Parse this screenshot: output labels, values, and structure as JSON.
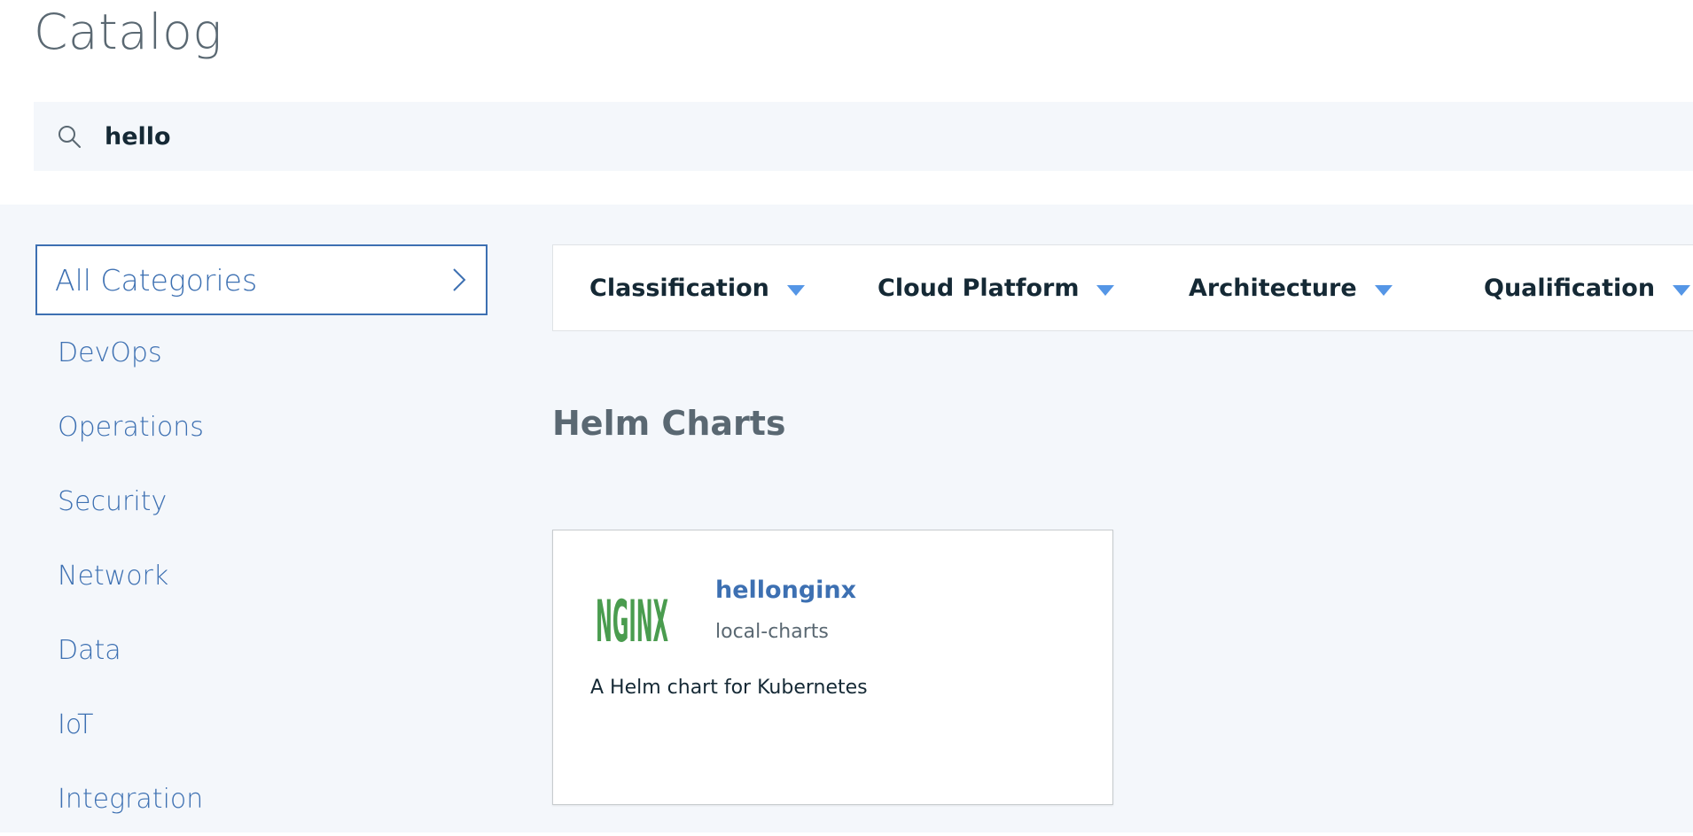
{
  "page": {
    "title": "Catalog"
  },
  "search": {
    "value": "hello",
    "icon": "search-icon"
  },
  "sidebar": {
    "all_categories_label": "All Categories",
    "categories": [
      "DevOps",
      "Operations",
      "Security",
      "Network",
      "Data",
      "IoT",
      "Integration"
    ]
  },
  "filters": [
    {
      "label": "Classification"
    },
    {
      "label": "Cloud Platform"
    },
    {
      "label": "Architecture"
    },
    {
      "label": "Qualification"
    }
  ],
  "results": {
    "section_title": "Helm Charts",
    "cards": [
      {
        "name": "hellonginx",
        "repo": "local-charts",
        "description": "A Helm chart for Kubernetes",
        "logo_text": "NGINX",
        "logo_color": "#4a9c4f"
      }
    ]
  },
  "colors": {
    "accent": "#3d70b2",
    "title_gray": "#5a6872",
    "text_dark": "#152935",
    "panel_bg": "#f4f7fb",
    "caret": "#5596e6"
  }
}
